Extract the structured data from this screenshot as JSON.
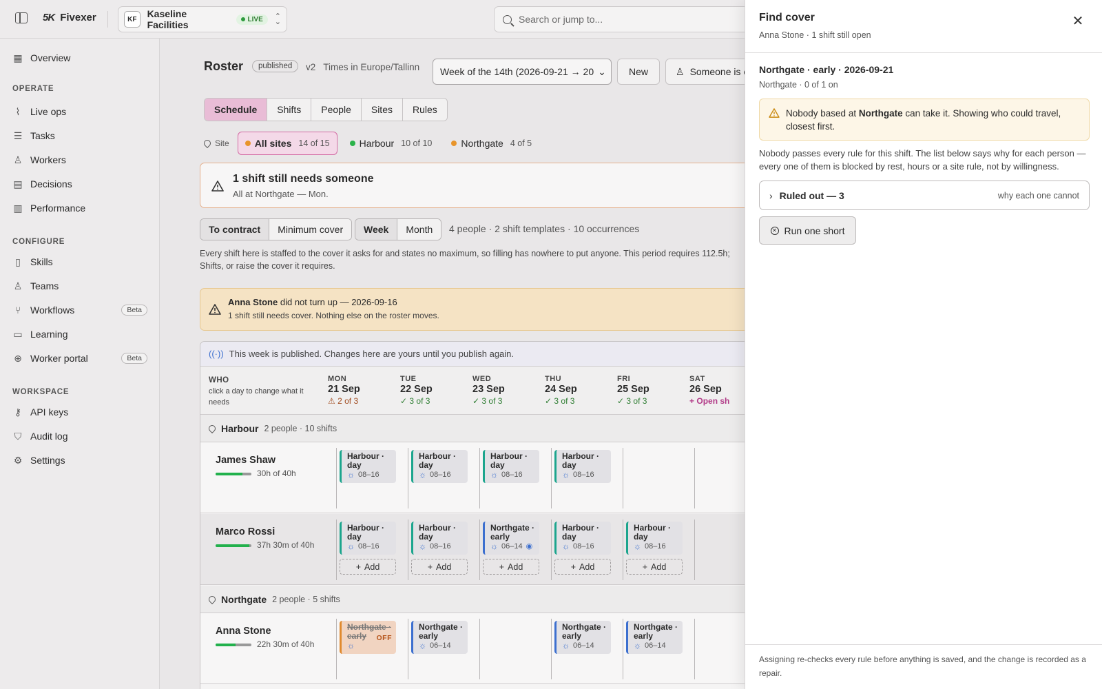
{
  "topbar": {
    "brand": "Fivexer",
    "org_initials": "KF",
    "org_name": "Kaseline Facilities",
    "org_status": "LIVE",
    "search_placeholder": "Search or jump to..."
  },
  "sidebar": {
    "overview": "Overview",
    "operate_title": "OPERATE",
    "operate": [
      "Live ops",
      "Tasks",
      "Workers",
      "Decisions",
      "Performance"
    ],
    "configure_title": "CONFIGURE",
    "configure": [
      "Skills",
      "Teams",
      "Workflows",
      "Learning",
      "Worker portal"
    ],
    "beta": "Beta",
    "workspace_title": "WORKSPACE",
    "workspace": [
      "API keys",
      "Audit log",
      "Settings"
    ]
  },
  "roster": {
    "title": "Roster",
    "status": "published",
    "version": "v2",
    "timezone": "Times in Europe/Tallinn",
    "week_label": "Week of the 14th (2026-09-21 → 20",
    "new_button": "New",
    "someone_button": "Someone is c",
    "tabs": [
      "Schedule",
      "Shifts",
      "People",
      "Sites",
      "Rules"
    ],
    "site_label": "Site",
    "sites": [
      {
        "name": "All sites",
        "count": "14 of 15",
        "color": "#e8952c"
      },
      {
        "name": "Harbour",
        "count": "10 of 10",
        "color": "#2bb34a"
      },
      {
        "name": "Northgate",
        "count": "4 of 5",
        "color": "#e8952c"
      }
    ],
    "alert_title": "1 shift still needs someone",
    "alert_sub": "All at Northgate — Mon.",
    "mode_options": [
      "To contract",
      "Minimum cover"
    ],
    "period_options": [
      "Week",
      "Month"
    ],
    "stats": "4 people · 2 shift templates · 10 occurrences",
    "para": "Every shift here is staffed to the cover it asks for and states no maximum, so filling has nowhere to put anyone. This period requires 112.5h; Shifts, or raise the cover it requires.",
    "absence_name": "Anna Stone",
    "absence_text": "did not turn up — 2026-09-16",
    "absence_sub": "1 shift still needs cover. Nothing else on the roster moves.",
    "published_note": "This week is published. Changes here are yours until you publish again.",
    "who_title": "WHO",
    "who_hint": "click a day to change what it needs",
    "days": [
      {
        "dow": "MON",
        "date": "21 Sep",
        "cover": "2 of 3",
        "state": "bad"
      },
      {
        "dow": "TUE",
        "date": "22 Sep",
        "cover": "3 of 3",
        "state": "ok"
      },
      {
        "dow": "WED",
        "date": "23 Sep",
        "cover": "3 of 3",
        "state": "ok"
      },
      {
        "dow": "THU",
        "date": "24 Sep",
        "cover": "3 of 3",
        "state": "ok"
      },
      {
        "dow": "FRI",
        "date": "25 Sep",
        "cover": "3 of 3",
        "state": "ok"
      },
      {
        "dow": "SAT",
        "date": "26 Sep",
        "cover": "Open sh",
        "state": "open"
      }
    ],
    "harbour": {
      "name": "Harbour",
      "meta": "2 people · 10 shifts"
    },
    "northgate": {
      "name": "Northgate",
      "meta": "2 people · 5 shifts"
    },
    "people": [
      {
        "name": "James Shaw",
        "hours": "30h of 40h",
        "fill": 0.75
      },
      {
        "name": "Marco Rossi",
        "hours": "37h 30m of 40h",
        "fill": 0.94
      },
      {
        "name": "Anna Stone",
        "hours": "22h 30m of 40h",
        "fill": 0.56
      }
    ],
    "shift_harbour_day": "Harbour · day",
    "shift_northgate_early": "Northgate · early",
    "time_day": "08–16",
    "time_early": "06–14",
    "off_tag": "OFF",
    "add": "Add"
  },
  "drawer": {
    "title": "Find cover",
    "subtitle": "Anna Stone · 1 shift still open",
    "shift_title": "Northgate · early · 2026-09-21",
    "shift_sub": "Northgate · 0 of 1 on",
    "warn_pre": "Nobody based at",
    "warn_site": "Northgate",
    "warn_post": "can take it. Showing who could travel, closest first.",
    "para": "Nobody passes every rule for this shift. The list below says why for each person — every one of them is blocked by rest, hours or a site rule, not by willingness.",
    "ruled_out": "Ruled out — 3",
    "ruled_hint": "why each one cannot",
    "run_short": "Run one short",
    "footer": "Assigning re-checks every rule before anything is saved, and the change is recorded as a repair."
  }
}
